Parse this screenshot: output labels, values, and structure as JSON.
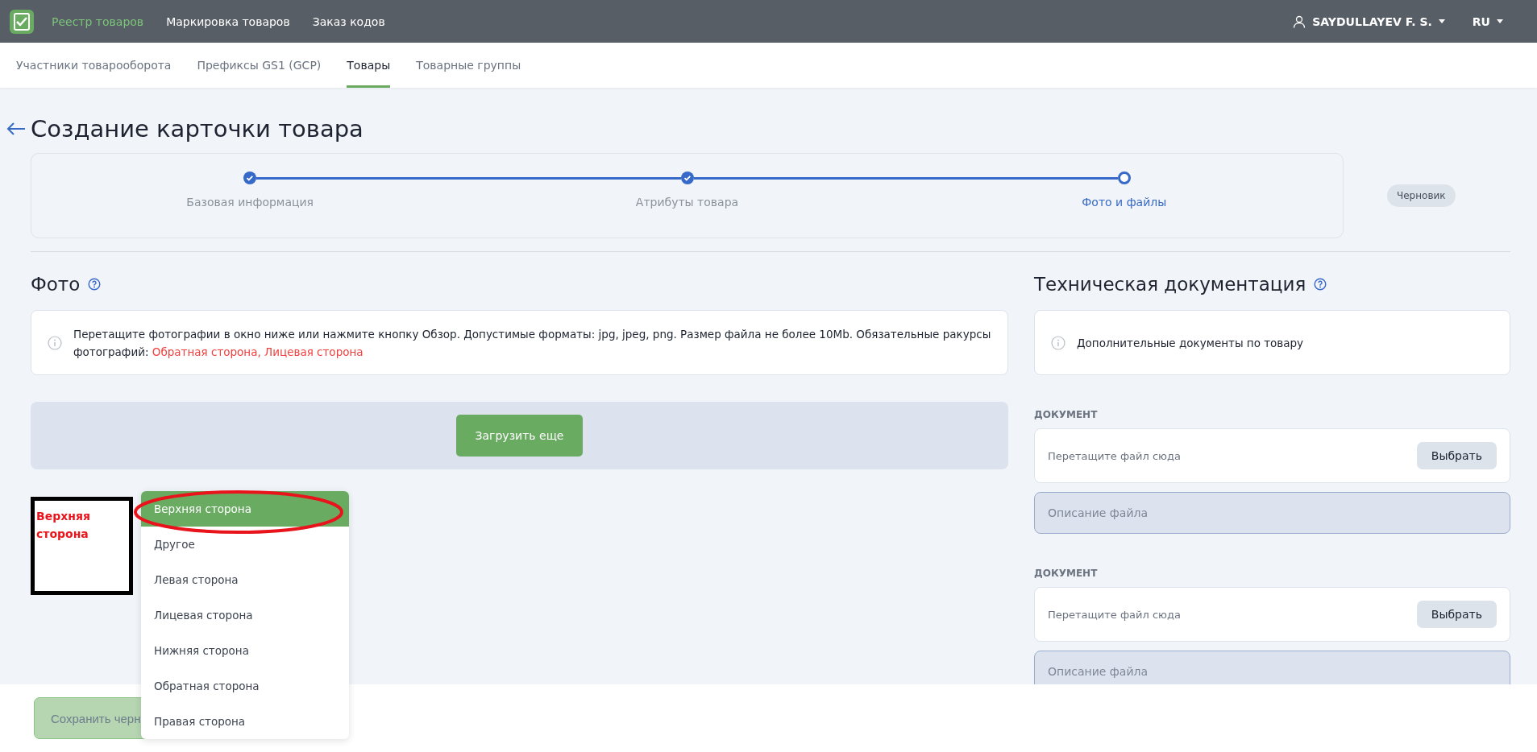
{
  "top_bar": {
    "nav": [
      {
        "label": "Реестр товаров",
        "selected": true
      },
      {
        "label": "Маркировка товаров",
        "selected": false
      },
      {
        "label": "Заказ кодов",
        "selected": false
      }
    ],
    "user": "SAYDULLAYEV F. S.",
    "language": "RU"
  },
  "tabs": [
    {
      "label": "Участники товарооборота",
      "selected": false
    },
    {
      "label": "Префиксы GS1 (GCP)",
      "selected": false
    },
    {
      "label": "Товары",
      "selected": true
    },
    {
      "label": "Товарные группы",
      "selected": false
    }
  ],
  "page_title": "Создание карточки товара",
  "steps": [
    {
      "label": "Базовая информация",
      "completed": true,
      "selected": false
    },
    {
      "label": "Атрибуты товара",
      "completed": true,
      "selected": false
    },
    {
      "label": "Фото и файлы",
      "completed": false,
      "selected": true
    }
  ],
  "status_badge": "Черновик",
  "photo": {
    "title": "Фото",
    "info_text": "Перетащите фотографии в окно ниже или нажмите кнопку Обзор. Допустимые форматы: jpg, jpeg, png. Размер файла не более 10Mb. Обязательные ракурсы фотографий:",
    "required_views": "Обратная сторона, Лицевая сторона",
    "upload_button": "Загрузить еще",
    "photos": [
      {
        "label": "Верхняя сторона"
      }
    ]
  },
  "view_menu": {
    "options": [
      {
        "label": "Верхняя сторона",
        "selected": true
      },
      {
        "label": "Другое",
        "selected": false
      },
      {
        "label": "Левая сторона",
        "selected": false
      },
      {
        "label": "Лицевая сторона",
        "selected": false
      },
      {
        "label": "Нижняя сторона",
        "selected": false
      },
      {
        "label": "Обратная сторона",
        "selected": false
      },
      {
        "label": "Правая сторона",
        "selected": false
      }
    ]
  },
  "tech_docs": {
    "title": "Техническая документация",
    "info": "Дополнительные документы по товару",
    "documents": [
      {
        "label": "ДОКУМЕНТ",
        "drop_hint": "Перетащите файл сюда",
        "button": "Выбрать",
        "description_placeholder": "Описание файла"
      },
      {
        "label": "ДОКУМЕНТ",
        "drop_hint": "Перетащите файл сюда",
        "button": "Выбрать",
        "description_placeholder": "Описание файла"
      }
    ]
  },
  "footer": {
    "save_button": "Сохранить черн"
  }
}
